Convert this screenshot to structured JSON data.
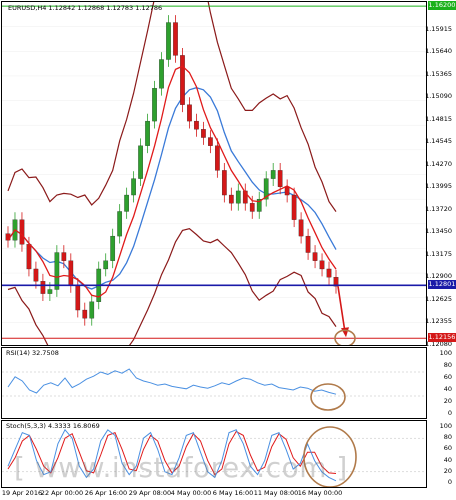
{
  "chart_title": "EURUSD,H4  1.12842 1.12868 1.12783 1.12786",
  "price_axis": [
    "1.15915",
    "1.15640",
    "1.15365",
    "1.15090",
    "1.14815",
    "1.14545",
    "1.14270",
    "1.13995",
    "1.13720",
    "1.13450",
    "1.13175",
    "1.12900",
    "1.12625",
    "1.12355",
    "1.12080"
  ],
  "levels": [
    {
      "label": "1.16200",
      "color": "#1bb11b",
      "price": 1.162
    },
    {
      "label": "1.12801",
      "color": "#1a1aa8",
      "price": 1.12801
    },
    {
      "label": "1.12156",
      "color": "#d41818",
      "price": 1.12156
    }
  ],
  "rsi_title": "RSI(14) 32.7508",
  "rsi_axis": [
    "100",
    "80",
    "60",
    "40",
    "20",
    "0"
  ],
  "stoch_title": "Stoch(5,3,3) 4.3333 16.8069",
  "stoch_axis": [
    "100",
    "80",
    "60",
    "40",
    "20",
    "0"
  ],
  "x_labels": [
    "19 Apr 2016",
    "22 Apr 00:00",
    "26 Apr 16:00",
    "29 Apr 08:00",
    "4 May 00:00",
    "6 May 16:00",
    "11 May 08:00",
    "16 May 00:00"
  ],
  "watermark": "[ www.instaforex.com ]",
  "colors": {
    "bull_candle": "#2ea02e",
    "bear_candle": "#d41818",
    "bollinger": "#8b1a1a",
    "ma_red": "#e01a1a",
    "ma_blue": "#3a7ad8",
    "rsi_line": "#4a90e2",
    "stoch_main": "#4a90e2",
    "stoch_signal": "#e01a1a",
    "annotation": "#b07a4a",
    "arrow": "#d41818"
  },
  "chart_data": {
    "type": "line",
    "series": [
      {
        "values": [
          1.1335,
          1.136,
          1.133,
          1.13,
          1.1285,
          1.127,
          1.1275,
          1.132,
          1.131,
          1.128,
          1.125,
          1.124,
          1.126,
          1.13,
          1.131,
          1.134,
          1.137,
          1.139,
          1.141,
          1.145,
          1.148,
          1.152,
          1.1555,
          1.16,
          1.156,
          1.15,
          1.148,
          1.147,
          1.146,
          1.145,
          1.142,
          1.139,
          1.138,
          1.1395,
          1.138,
          1.137,
          1.1385,
          1.141,
          1.142,
          1.14,
          1.139,
          1.136,
          1.134,
          1.132,
          1.131,
          1.13,
          1.129,
          1.1279
        ]
      }
    ],
    "ylim": [
      1.1205,
      1.1625
    ]
  },
  "rsi_data": [
    45,
    62,
    55,
    40,
    35,
    48,
    52,
    47,
    60,
    44,
    50,
    58,
    63,
    70,
    66,
    72,
    68,
    75,
    60,
    55,
    52,
    48,
    50,
    46,
    44,
    42,
    48,
    45,
    43,
    47,
    52,
    49,
    55,
    60,
    58,
    52,
    48,
    50,
    44,
    42,
    40,
    45,
    43,
    38,
    40,
    36,
    33
  ],
  "stoch_main": [
    30,
    60,
    90,
    85,
    40,
    15,
    20,
    70,
    95,
    80,
    30,
    10,
    25,
    75,
    95,
    85,
    35,
    15,
    30,
    80,
    90,
    60,
    20,
    15,
    45,
    85,
    90,
    55,
    20,
    10,
    40,
    90,
    95,
    70,
    30,
    15,
    40,
    85,
    90,
    60,
    25,
    35,
    70,
    40,
    20,
    10,
    4
  ],
  "stoch_signal": [
    25,
    45,
    75,
    85,
    60,
    30,
    18,
    45,
    80,
    88,
    55,
    22,
    18,
    50,
    85,
    90,
    60,
    25,
    22,
    60,
    85,
    75,
    40,
    18,
    30,
    65,
    88,
    75,
    40,
    15,
    25,
    70,
    92,
    85,
    50,
    22,
    28,
    65,
    88,
    78,
    45,
    30,
    55,
    55,
    30,
    18,
    17
  ]
}
